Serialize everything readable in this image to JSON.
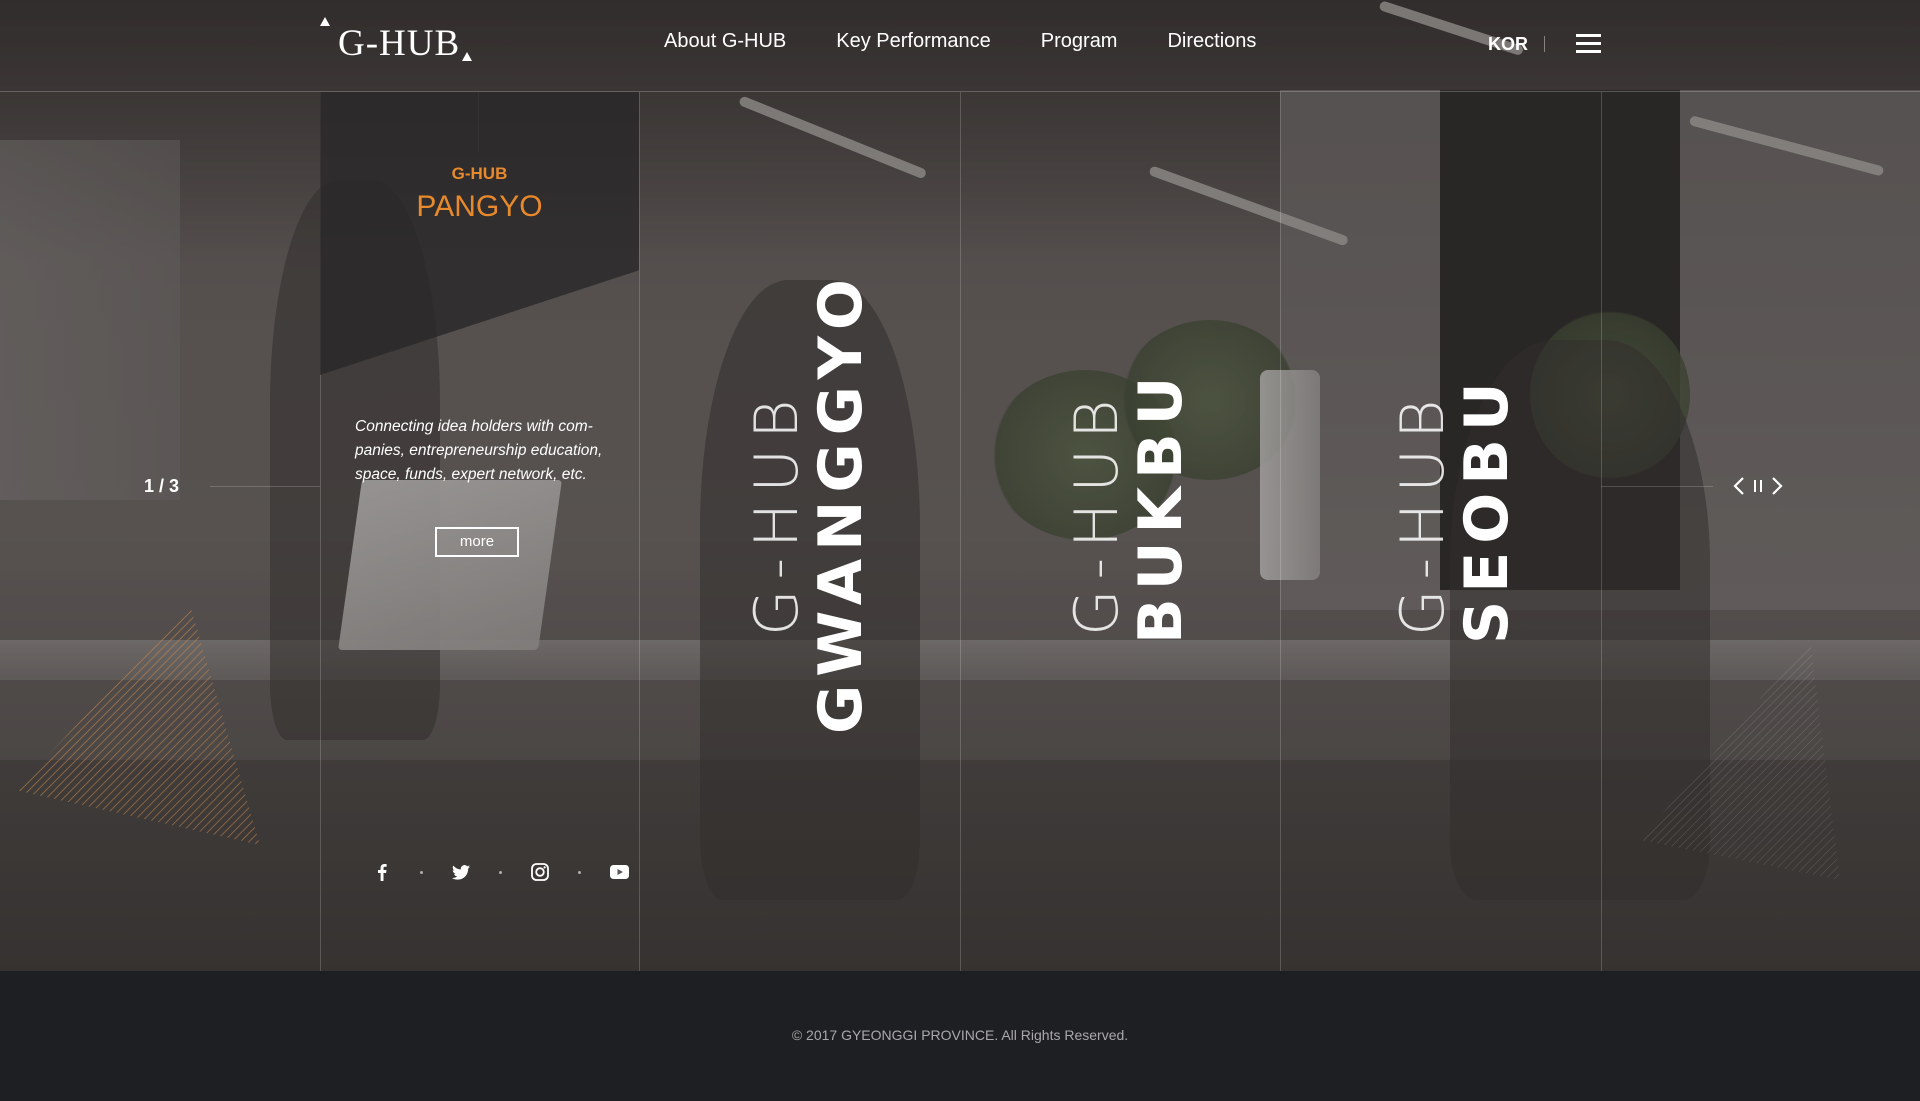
{
  "header": {
    "logo_text": "G-HUB",
    "nav": [
      "About G-HUB",
      "Key Performance",
      "Program",
      "Directions"
    ],
    "lang": "KOR"
  },
  "hero": {
    "counter": "1 / 3",
    "active": {
      "prefix": "G-HUB",
      "name": "PANGYO",
      "description": "Connecting idea holders with com- panies, entrepreneurship education, space, funds, expert network, etc.",
      "more_label": "more"
    },
    "slides": [
      {
        "thin": "G-HUB",
        "bold": "GWANGGYO"
      },
      {
        "thin": "G-HUB",
        "bold": "BUKBU"
      },
      {
        "thin": "G-HUB",
        "bold": "SEOBU"
      }
    ]
  },
  "social": [
    "facebook-icon",
    "twitter-icon",
    "instagram-icon",
    "youtube-icon"
  ],
  "colors": {
    "accent": "#e8892c",
    "footer_bg": "#1e1f22"
  },
  "footer": {
    "copyright": "© 2017 GYEONGGI PROVINCE. All Rights Reserved."
  }
}
